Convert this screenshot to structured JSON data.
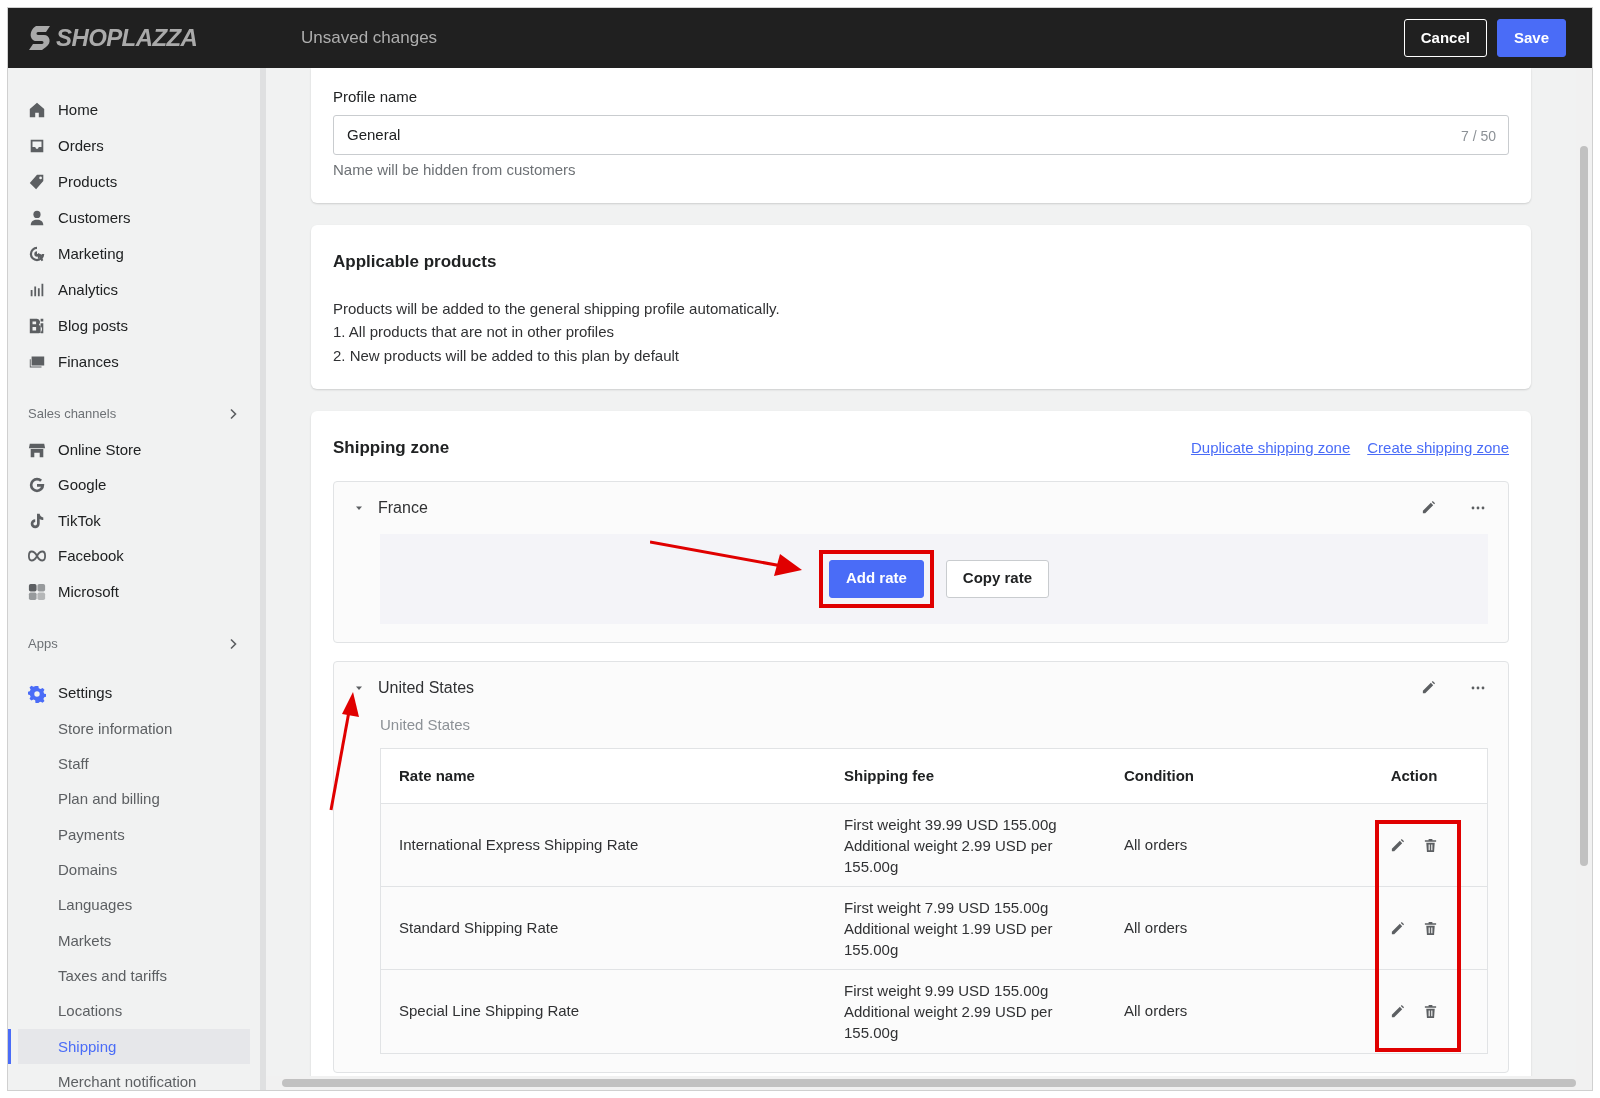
{
  "header": {
    "logo": "SHOPLAZZA",
    "status": "Unsaved changes",
    "buttons": [
      {
        "label": "Cancel",
        "kind": "secondary"
      },
      {
        "label": "Save",
        "kind": "primary"
      }
    ]
  },
  "sidebar": {
    "items": [
      {
        "label": "Home"
      },
      {
        "label": "Orders"
      },
      {
        "label": "Products"
      },
      {
        "label": "Customers"
      },
      {
        "label": "Marketing"
      },
      {
        "label": "Analytics"
      },
      {
        "label": "Blog posts"
      },
      {
        "label": "Finances"
      }
    ],
    "sections": [
      {
        "title": "Sales channels",
        "items": [
          {
            "label": "Online Store"
          },
          {
            "label": "Google"
          },
          {
            "label": "TikTok"
          },
          {
            "label": "Facebook"
          },
          {
            "label": "Microsoft"
          }
        ]
      },
      {
        "title": "Apps"
      }
    ],
    "settings": {
      "label": "Settings",
      "children": [
        {
          "label": "Store information",
          "selected": false
        },
        {
          "label": "Staff",
          "selected": false
        },
        {
          "label": "Plan and billing",
          "selected": false
        },
        {
          "label": "Payments",
          "selected": false
        },
        {
          "label": "Domains",
          "selected": false
        },
        {
          "label": "Languages",
          "selected": false
        },
        {
          "label": "Markets",
          "selected": false
        },
        {
          "label": "Taxes and tariffs",
          "selected": false
        },
        {
          "label": "Locations",
          "selected": false
        },
        {
          "label": "Shipping",
          "selected": true
        },
        {
          "label": "Merchant notification",
          "selected": false
        }
      ]
    }
  },
  "profile": {
    "label": "Profile name",
    "value": "General",
    "counter": "7 / 50",
    "help": "Name will be hidden from customers"
  },
  "applicable_products": {
    "title": "Applicable products",
    "lines": [
      "Products will be added to the general shipping profile automatically.",
      "1. All products that are not in other profiles",
      "2. New products will be added to this plan by default"
    ]
  },
  "shipping_zone": {
    "title": "Shipping zone",
    "links": [
      "Duplicate shipping zone",
      "Create shipping zone"
    ],
    "zones": [
      {
        "name": "France",
        "expanded": true,
        "buttons": [
          {
            "label": "Add rate",
            "kind": "primary"
          },
          {
            "label": "Copy rate",
            "kind": "secondary"
          }
        ]
      },
      {
        "name": "United States",
        "expanded": true,
        "subtitle": "United States",
        "table": {
          "columns": [
            "Rate name",
            "Shipping fee",
            "Condition",
            "Action"
          ],
          "rows": [
            {
              "rate_name": "International Express Shipping Rate",
              "fee": [
                "First weight 39.99 USD 155.00g",
                "Additional weight 2.99 USD per 155.00g"
              ],
              "condition": "All orders"
            },
            {
              "rate_name": "Standard Shipping Rate",
              "fee": [
                "First weight 7.99 USD 155.00g",
                "Additional weight 1.99 USD per 155.00g"
              ],
              "condition": "All orders"
            },
            {
              "rate_name": "Special Line Shipping Rate",
              "fee": [
                "First weight 9.99 USD 155.00g",
                "Additional weight 2.99 USD per 155.00g"
              ],
              "condition": "All orders"
            }
          ]
        }
      }
    ]
  }
}
